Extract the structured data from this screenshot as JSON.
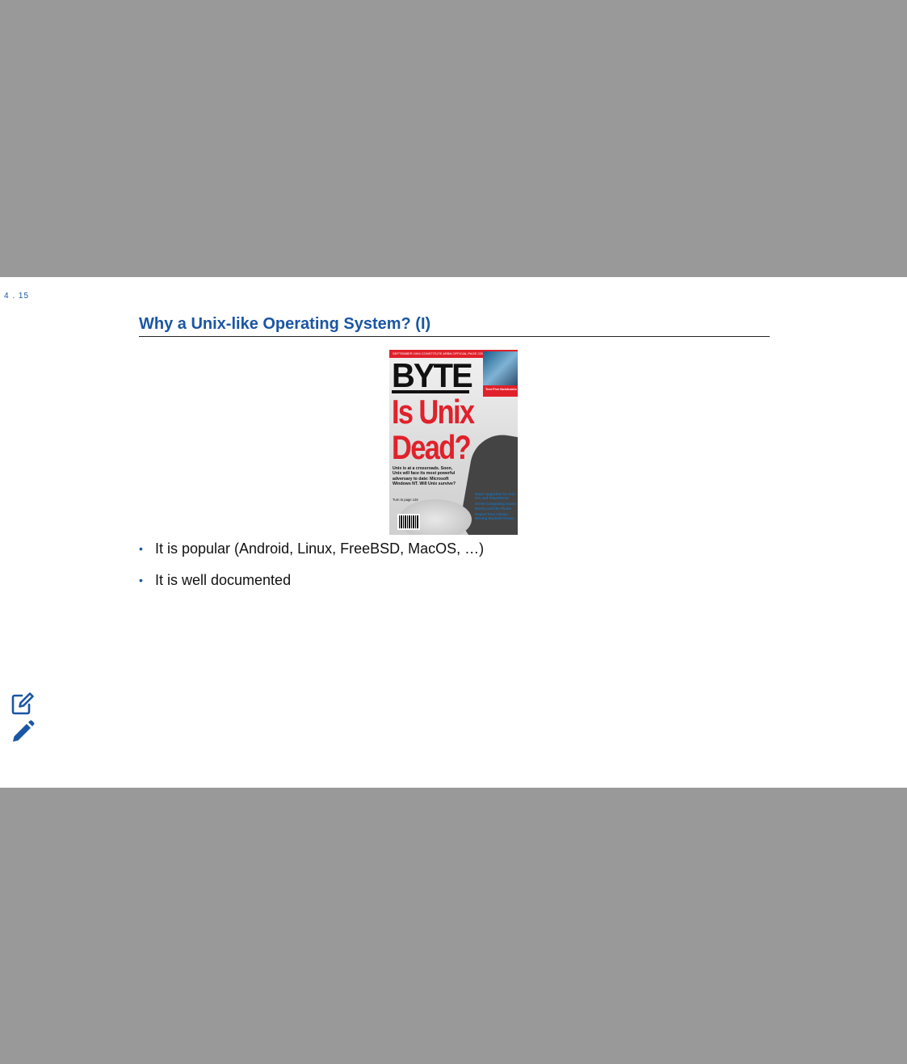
{
  "slide": {
    "number": "4 . 15",
    "title": "Why a Unix-like Operating System? (I)"
  },
  "cover": {
    "topbar": "SEPTEMBER 1994     CONSTITUTE ARBN OFFICIAL     PAGE 220",
    "masthead": "BYTE",
    "side_box": "Test Five Notebooks",
    "headline_line1": "Is Unix",
    "headline_line2": "Dead?",
    "deck": "Unix is at a crossroads. Soon, Unix will face its most powerful adversary to date: Microsoft Windows NT. Will Unix survive?",
    "deck_sub": "Turn to page 134",
    "sidebar": [
      "Major Upgrades for Ami Pro and PowerPoint",
      "Green Computing Saves Money and the Planet",
      "Report from Taiwan: Moving Beyond Clones"
    ]
  },
  "bullets": [
    "It is popular (Android, Linux, FreeBSD, MacOS, …)",
    "It is well documented"
  ],
  "icons": {
    "edit": "edit-note-icon",
    "pencil": "pencil-icon"
  }
}
